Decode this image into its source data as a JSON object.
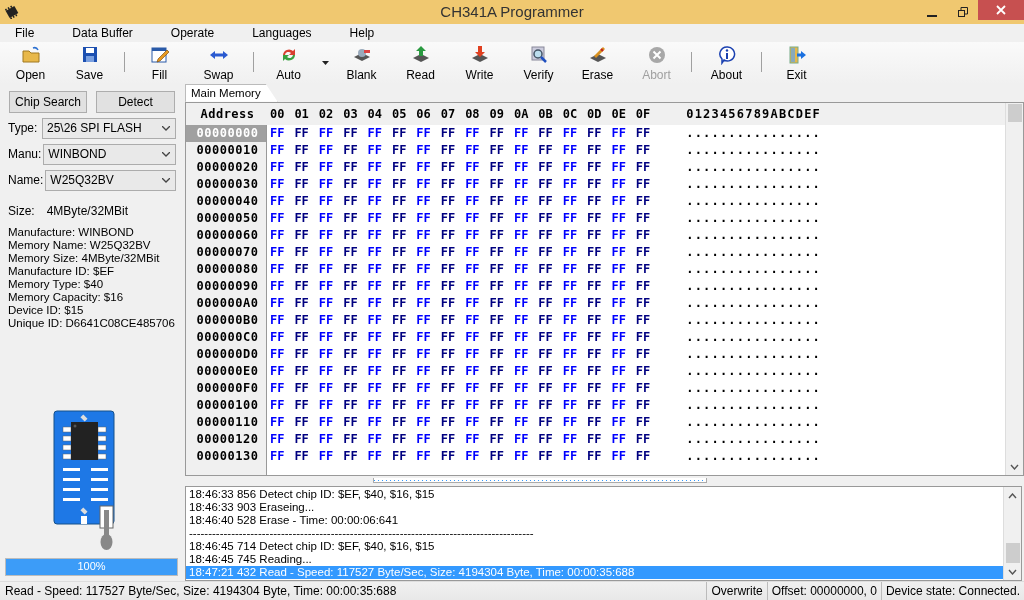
{
  "window": {
    "title": "CH341A Programmer"
  },
  "menu": [
    "File",
    "Data Buffer",
    "Operate",
    "Languages",
    "Help"
  ],
  "toolbar": [
    {
      "kind": "button",
      "label": "Open",
      "disabled": false,
      "dropdown": false
    },
    {
      "kind": "button",
      "label": "Save",
      "disabled": false,
      "dropdown": false
    },
    {
      "kind": "separator"
    },
    {
      "kind": "button",
      "label": "Fill",
      "disabled": false,
      "dropdown": false
    },
    {
      "kind": "button",
      "label": "Swap",
      "disabled": false,
      "dropdown": false
    },
    {
      "kind": "separator"
    },
    {
      "kind": "button",
      "label": "Auto",
      "disabled": false,
      "dropdown": true
    },
    {
      "kind": "button",
      "label": "Blank",
      "disabled": false,
      "dropdown": false
    },
    {
      "kind": "button",
      "label": "Read",
      "disabled": false,
      "dropdown": false
    },
    {
      "kind": "button",
      "label": "Write",
      "disabled": false,
      "dropdown": false
    },
    {
      "kind": "button",
      "label": "Verify",
      "disabled": false,
      "dropdown": false
    },
    {
      "kind": "button",
      "label": "Erase",
      "disabled": false,
      "dropdown": false
    },
    {
      "kind": "button",
      "label": "Abort",
      "disabled": true,
      "dropdown": false
    },
    {
      "kind": "separator"
    },
    {
      "kind": "button",
      "label": "About",
      "disabled": false,
      "dropdown": false
    },
    {
      "kind": "separator"
    },
    {
      "kind": "button",
      "label": "Exit",
      "disabled": false,
      "dropdown": false
    }
  ],
  "chip_panel": {
    "buttons": [
      "Chip Search",
      "Detect"
    ],
    "selects": [
      {
        "label": "Type:",
        "value": "25\\26 SPI FLASH"
      },
      {
        "label": "Manu:",
        "value": "WINBOND"
      },
      {
        "label": "Name:",
        "value": "W25Q32BV"
      }
    ],
    "size": {
      "label": "Size:",
      "value": "4MByte/32MBit"
    },
    "info": [
      "Manufacture: WINBOND",
      "Memory Name: W25Q32BV",
      "Memory Size: 4MByte/32MBit",
      "Manufacture ID: $EF",
      "Memory Type: $40",
      "Memory Capacity: $16",
      "Device ID: $15",
      "Unique ID: D6641C08CE485706"
    ],
    "progress": {
      "level": 1,
      "text": "100%"
    }
  },
  "tabs": [
    {
      "label": "Main Memory",
      "selected": true
    }
  ],
  "hex": {
    "header": {
      "address": "Address",
      "columns": [
        "00",
        "01",
        "02",
        "03",
        "04",
        "05",
        "06",
        "07",
        "08",
        "09",
        "0A",
        "0B",
        "0C",
        "0D",
        "0E",
        "0F"
      ],
      "ascii": "0123456789ABCDEF"
    },
    "rows": [
      {
        "address": "00000000",
        "selected": true,
        "bytes": [
          "FF",
          "FF",
          "FF",
          "FF",
          "FF",
          "FF",
          "FF",
          "FF",
          "FF",
          "FF",
          "FF",
          "FF",
          "FF",
          "FF",
          "FF",
          "FF"
        ],
        "ascii": "................"
      },
      {
        "address": "00000010",
        "selected": false,
        "bytes": [
          "FF",
          "FF",
          "FF",
          "FF",
          "FF",
          "FF",
          "FF",
          "FF",
          "FF",
          "FF",
          "FF",
          "FF",
          "FF",
          "FF",
          "FF",
          "FF"
        ],
        "ascii": "................"
      },
      {
        "address": "00000020",
        "selected": false,
        "bytes": [
          "FF",
          "FF",
          "FF",
          "FF",
          "FF",
          "FF",
          "FF",
          "FF",
          "FF",
          "FF",
          "FF",
          "FF",
          "FF",
          "FF",
          "FF",
          "FF"
        ],
        "ascii": "................"
      },
      {
        "address": "00000030",
        "selected": false,
        "bytes": [
          "FF",
          "FF",
          "FF",
          "FF",
          "FF",
          "FF",
          "FF",
          "FF",
          "FF",
          "FF",
          "FF",
          "FF",
          "FF",
          "FF",
          "FF",
          "FF"
        ],
        "ascii": "................"
      },
      {
        "address": "00000040",
        "selected": false,
        "bytes": [
          "FF",
          "FF",
          "FF",
          "FF",
          "FF",
          "FF",
          "FF",
          "FF",
          "FF",
          "FF",
          "FF",
          "FF",
          "FF",
          "FF",
          "FF",
          "FF"
        ],
        "ascii": "................"
      },
      {
        "address": "00000050",
        "selected": false,
        "bytes": [
          "FF",
          "FF",
          "FF",
          "FF",
          "FF",
          "FF",
          "FF",
          "FF",
          "FF",
          "FF",
          "FF",
          "FF",
          "FF",
          "FF",
          "FF",
          "FF"
        ],
        "ascii": "................"
      },
      {
        "address": "00000060",
        "selected": false,
        "bytes": [
          "FF",
          "FF",
          "FF",
          "FF",
          "FF",
          "FF",
          "FF",
          "FF",
          "FF",
          "FF",
          "FF",
          "FF",
          "FF",
          "FF",
          "FF",
          "FF"
        ],
        "ascii": "................"
      },
      {
        "address": "00000070",
        "selected": false,
        "bytes": [
          "FF",
          "FF",
          "FF",
          "FF",
          "FF",
          "FF",
          "FF",
          "FF",
          "FF",
          "FF",
          "FF",
          "FF",
          "FF",
          "FF",
          "FF",
          "FF"
        ],
        "ascii": "................"
      },
      {
        "address": "00000080",
        "selected": false,
        "bytes": [
          "FF",
          "FF",
          "FF",
          "FF",
          "FF",
          "FF",
          "FF",
          "FF",
          "FF",
          "FF",
          "FF",
          "FF",
          "FF",
          "FF",
          "FF",
          "FF"
        ],
        "ascii": "................"
      },
      {
        "address": "00000090",
        "selected": false,
        "bytes": [
          "FF",
          "FF",
          "FF",
          "FF",
          "FF",
          "FF",
          "FF",
          "FF",
          "FF",
          "FF",
          "FF",
          "FF",
          "FF",
          "FF",
          "FF",
          "FF"
        ],
        "ascii": "................"
      },
      {
        "address": "000000A0",
        "selected": false,
        "bytes": [
          "FF",
          "FF",
          "FF",
          "FF",
          "FF",
          "FF",
          "FF",
          "FF",
          "FF",
          "FF",
          "FF",
          "FF",
          "FF",
          "FF",
          "FF",
          "FF"
        ],
        "ascii": "................"
      },
      {
        "address": "000000B0",
        "selected": false,
        "bytes": [
          "FF",
          "FF",
          "FF",
          "FF",
          "FF",
          "FF",
          "FF",
          "FF",
          "FF",
          "FF",
          "FF",
          "FF",
          "FF",
          "FF",
          "FF",
          "FF"
        ],
        "ascii": "................"
      },
      {
        "address": "000000C0",
        "selected": false,
        "bytes": [
          "FF",
          "FF",
          "FF",
          "FF",
          "FF",
          "FF",
          "FF",
          "FF",
          "FF",
          "FF",
          "FF",
          "FF",
          "FF",
          "FF",
          "FF",
          "FF"
        ],
        "ascii": "................"
      },
      {
        "address": "000000D0",
        "selected": false,
        "bytes": [
          "FF",
          "FF",
          "FF",
          "FF",
          "FF",
          "FF",
          "FF",
          "FF",
          "FF",
          "FF",
          "FF",
          "FF",
          "FF",
          "FF",
          "FF",
          "FF"
        ],
        "ascii": "................"
      },
      {
        "address": "000000E0",
        "selected": false,
        "bytes": [
          "FF",
          "FF",
          "FF",
          "FF",
          "FF",
          "FF",
          "FF",
          "FF",
          "FF",
          "FF",
          "FF",
          "FF",
          "FF",
          "FF",
          "FF",
          "FF"
        ],
        "ascii": "................"
      },
      {
        "address": "000000F0",
        "selected": false,
        "bytes": [
          "FF",
          "FF",
          "FF",
          "FF",
          "FF",
          "FF",
          "FF",
          "FF",
          "FF",
          "FF",
          "FF",
          "FF",
          "FF",
          "FF",
          "FF",
          "FF"
        ],
        "ascii": "................"
      },
      {
        "address": "00000100",
        "selected": false,
        "bytes": [
          "FF",
          "FF",
          "FF",
          "FF",
          "FF",
          "FF",
          "FF",
          "FF",
          "FF",
          "FF",
          "FF",
          "FF",
          "FF",
          "FF",
          "FF",
          "FF"
        ],
        "ascii": "................"
      },
      {
        "address": "00000110",
        "selected": false,
        "bytes": [
          "FF",
          "FF",
          "FF",
          "FF",
          "FF",
          "FF",
          "FF",
          "FF",
          "FF",
          "FF",
          "FF",
          "FF",
          "FF",
          "FF",
          "FF",
          "FF"
        ],
        "ascii": "................"
      },
      {
        "address": "00000120",
        "selected": false,
        "bytes": [
          "FF",
          "FF",
          "FF",
          "FF",
          "FF",
          "FF",
          "FF",
          "FF",
          "FF",
          "FF",
          "FF",
          "FF",
          "FF",
          "FF",
          "FF",
          "FF"
        ],
        "ascii": "................"
      },
      {
        "address": "00000130",
        "selected": false,
        "bytes": [
          "FF",
          "FF",
          "FF",
          "FF",
          "FF",
          "FF",
          "FF",
          "FF",
          "FF",
          "FF",
          "FF",
          "FF",
          "FF",
          "FF",
          "FF",
          "FF"
        ],
        "ascii": "................"
      }
    ]
  },
  "log": {
    "lines": [
      {
        "text": "18:46:33 856 Detect chip ID: $EF, $40, $16, $15",
        "selected": false
      },
      {
        "text": "18:46:33 903 Eraseing...",
        "selected": false
      },
      {
        "text": "18:46:40 528 Erase - Time: 00:00:06:641",
        "selected": false
      },
      {
        "text": "------------------------------------------------------------------------------------------",
        "selected": false
      },
      {
        "text": "18:46:45 714 Detect chip ID: $EF, $40, $16, $15",
        "selected": false
      },
      {
        "text": "18:46:45 745 Reading...",
        "selected": false
      },
      {
        "text": "18:47:21 432 Read - Speed: 117527 Byte/Sec, Size: 4194304 Byte, Time: 00:00:35:688",
        "selected": true
      }
    ]
  },
  "status_bar": {
    "message": "Read - Speed: 117527 Byte/Sec, Size: 4194304 Byte, Time: 00:00:35:688",
    "mode": "Overwrite",
    "offset": "Offset: 00000000, 0",
    "device": "Device state: Connected."
  }
}
